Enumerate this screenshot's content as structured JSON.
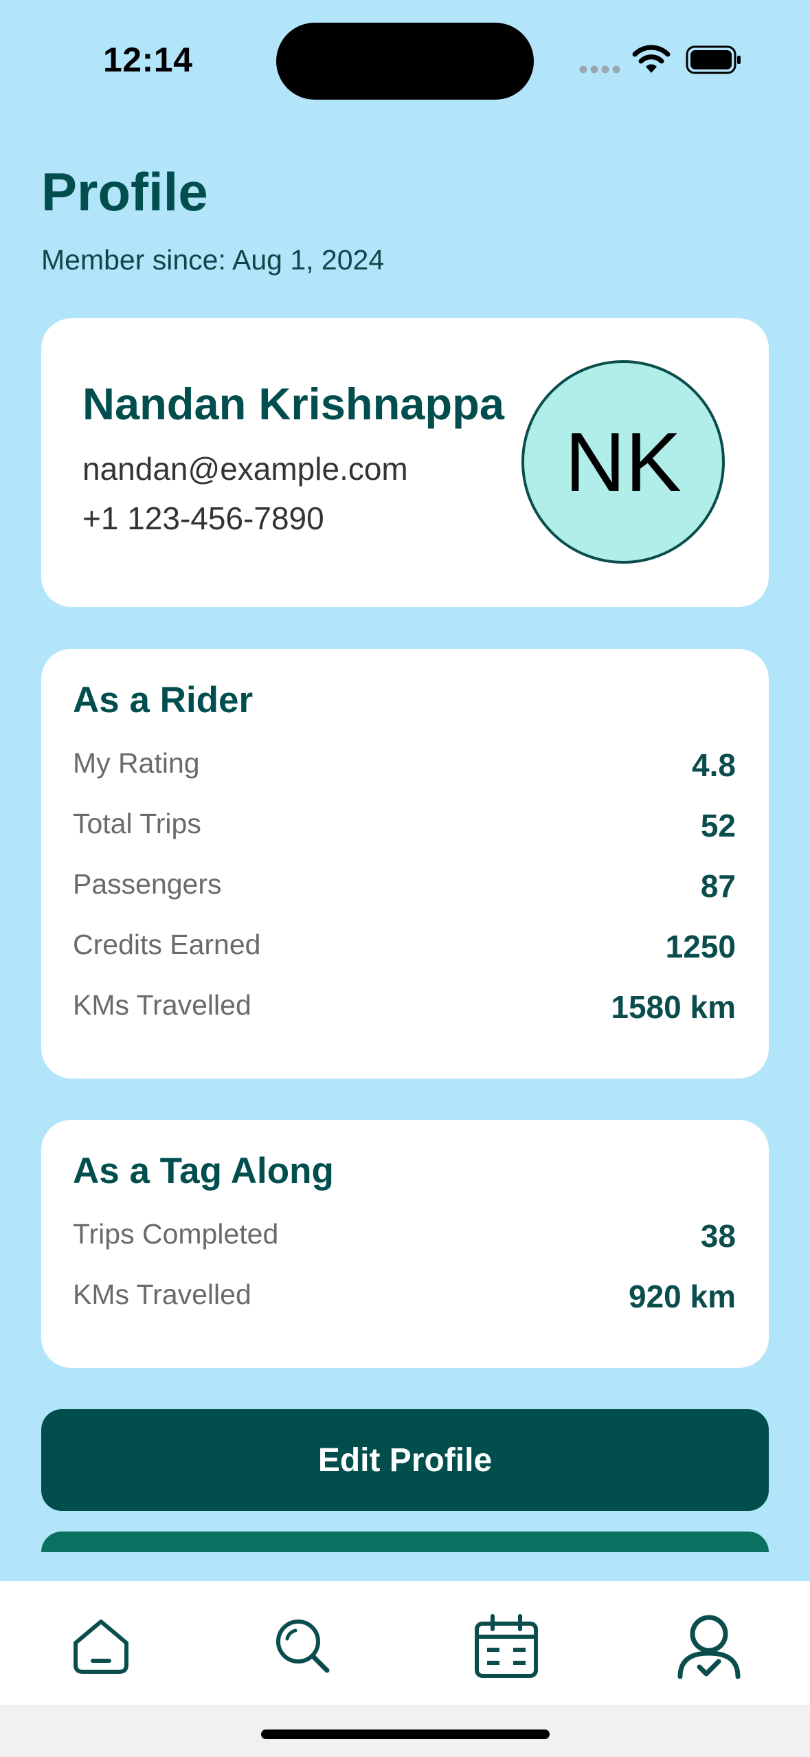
{
  "status_bar": {
    "time": "12:14"
  },
  "header": {
    "title": "Profile",
    "member_since": "Member since: Aug 1, 2024"
  },
  "profile": {
    "name": "Nandan Krishnappa",
    "email": "nandan@example.com",
    "phone": "+1 123-456-7890",
    "initials": "NK"
  },
  "rider": {
    "title": "As a Rider",
    "rows": [
      {
        "label": "My Rating",
        "value": "4.8"
      },
      {
        "label": "Total Trips",
        "value": "52"
      },
      {
        "label": "Passengers",
        "value": "87"
      },
      {
        "label": "Credits Earned",
        "value": "1250"
      },
      {
        "label": "KMs Travelled",
        "value": "1580 km"
      }
    ]
  },
  "tag_along": {
    "title": "As a Tag Along",
    "rows": [
      {
        "label": "Trips Completed",
        "value": "38"
      },
      {
        "label": "KMs Travelled",
        "value": "920 km"
      }
    ]
  },
  "actions": {
    "edit_profile": "Edit Profile"
  },
  "tab_bar": {
    "items": [
      {
        "icon": "home-icon"
      },
      {
        "icon": "search-icon"
      },
      {
        "icon": "calendar-icon"
      },
      {
        "icon": "profile-icon",
        "active": true
      }
    ]
  },
  "colors": {
    "background": "#b3e5fa",
    "primary": "#024e4e",
    "avatar_fill": "#b1ede9"
  }
}
